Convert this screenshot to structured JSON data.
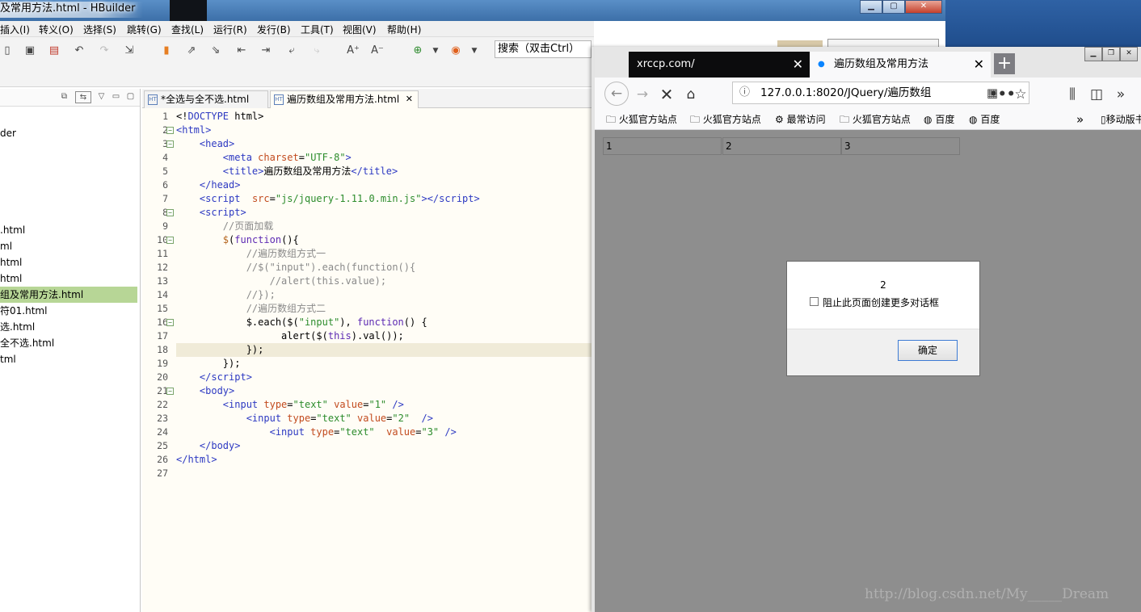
{
  "hbuilder": {
    "title": "及常用方法.html  -  HBuilder",
    "menu": [
      "插入(I)",
      "转义(O)",
      "选择(S)",
      "跳转(G)",
      "查找(L)",
      "运行(R)",
      "发行(B)",
      "工具(T)",
      "视图(V)",
      "帮助(H)"
    ],
    "search_placeholder": "搜索（双击Ctrl）",
    "tree": [
      "der",
      ".html",
      "ml",
      "html",
      "html",
      "组及常用方法.html",
      "符01.html",
      "选.html",
      "全不选.html",
      "tml"
    ],
    "selected_tree_index": 5,
    "tabs": [
      "*全选与全不选.html",
      "遍历数组及常用方法.html"
    ],
    "active_tab": 1
  },
  "firefox": {
    "tabs": [
      "xrccp.com/",
      "遍历数组及常用方法"
    ],
    "url": "127.0.0.1:8020/JQuery/遍历数组",
    "bookmarks": [
      "火狐官方站点",
      "火狐官方站点",
      "最常访问",
      "火狐官方站点",
      "百度",
      "百度",
      "移动版书"
    ],
    "inputs": [
      "1",
      "2",
      "3"
    ],
    "dialog": {
      "message": "2",
      "checkbox_label": "阻止此页面创建更多对话框",
      "ok": "确定"
    }
  },
  "watermark": "http://blog.csdn.net/My_____Dream",
  "colors": {
    "selected_tree": "#b7d696",
    "editor_bg": "#fffdf6",
    "firefox_content": "#8e8e8e"
  }
}
